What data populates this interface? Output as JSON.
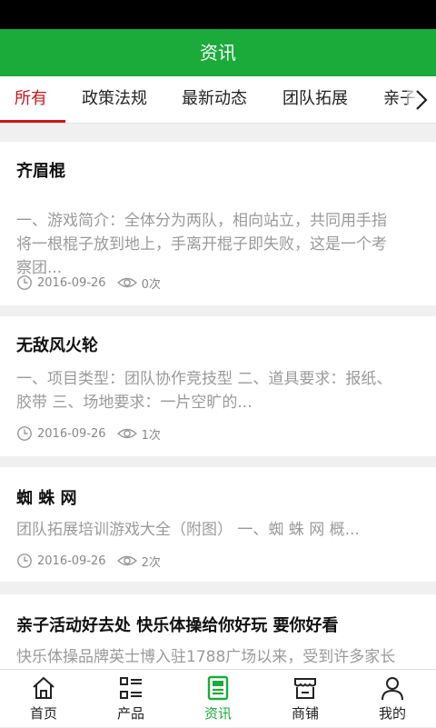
{
  "header": {
    "title": "资讯"
  },
  "tabs": [
    {
      "label": "所有"
    },
    {
      "label": "政策法规"
    },
    {
      "label": "最新动态"
    },
    {
      "label": "团队拓展"
    },
    {
      "label": "亲子"
    }
  ],
  "articles": [
    {
      "title": "齐眉棍",
      "summary_lines": [
        "一、游戏简介：全体分为两队，相向站立，共同用手指",
        "将一根棍子放到地上，手离开棍子即失败，这是一个考",
        "察团..."
      ],
      "date": "2016-09-26",
      "views": "0次"
    },
    {
      "title": "无敌风火轮",
      "summary_lines": [
        "一、项目类型：团队协作竞技型 二、道具要求：报纸、",
        "胶带 三、场地要求：一片空旷的..."
      ],
      "date": "2016-09-26",
      "views": "1次"
    },
    {
      "title": "蜘 蛛 网",
      "summary_lines": [
        "团队拓展培训游戏大全（附图） 一、蜘 蛛 网  概..."
      ],
      "date": "2016-09-26",
      "views": "2次"
    },
    {
      "title": "亲子活动好去处 快乐体操给你好玩 要你好看",
      "summary_lines": [
        "快乐体操品牌英士博入驻1788广场以来，受到许多家长"
      ],
      "date": "",
      "views": ""
    }
  ],
  "bottom_nav": [
    {
      "label": "首页",
      "icon": "home-icon"
    },
    {
      "label": "产品",
      "icon": "product-list-icon"
    },
    {
      "label": "资讯",
      "icon": "news-icon"
    },
    {
      "label": "商铺",
      "icon": "shop-icon"
    },
    {
      "label": "我的",
      "icon": "user-icon"
    }
  ],
  "colors": {
    "brand_green": "#1aab3a",
    "active_tab_red": "#c8161d"
  }
}
